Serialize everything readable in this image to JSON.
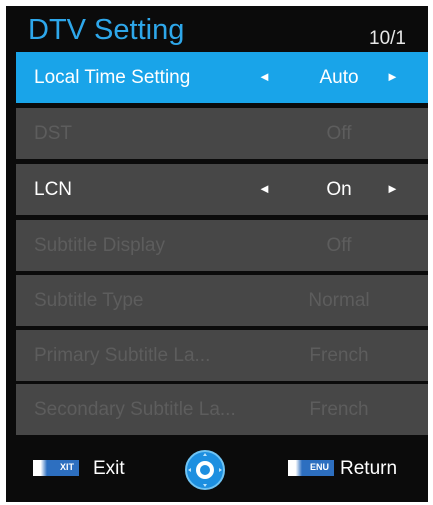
{
  "header": {
    "title": "DTV Setting",
    "page_indicator": "10/1"
  },
  "menu": {
    "items": [
      {
        "label": "Local Time Setting",
        "value": "Auto",
        "state": "selected",
        "arrows": true
      },
      {
        "label": "DST",
        "value": "Off",
        "state": "disabled",
        "arrows": false
      },
      {
        "label": "LCN",
        "value": "On",
        "state": "enabled",
        "arrows": true
      },
      {
        "label": "Subtitle Display",
        "value": "Off",
        "state": "disabled",
        "arrows": false
      },
      {
        "label": "Subtitle Type",
        "value": "Normal",
        "state": "disabled",
        "arrows": false
      },
      {
        "label": "Primary Subtitle La...",
        "value": "French",
        "state": "disabled",
        "arrows": false
      },
      {
        "label": "Secondary Subtitle La...",
        "value": "French",
        "state": "disabled",
        "arrows": false
      }
    ],
    "arrow_left": "◄",
    "arrow_right": "►"
  },
  "footer": {
    "exit_key_text": "XIT",
    "exit_label": "Exit",
    "ok_icon": "navigation-ok-icon",
    "menu_key_text": "ENU",
    "return_label": "Return"
  },
  "colors": {
    "accent": "#19a4e9",
    "title": "#2ea7ea",
    "row_bg": "#474747",
    "disabled_text": "#5d5d5d",
    "background": "#0b0b0b"
  }
}
